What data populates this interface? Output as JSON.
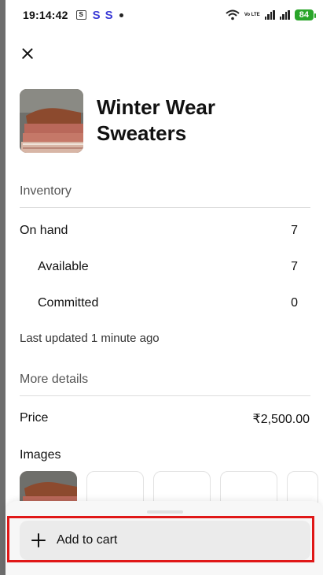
{
  "status_bar": {
    "time": "19:14:42",
    "sim_label": "S",
    "notif_1": "S",
    "notif_2": "S",
    "volte_text": "Vo LTE",
    "battery": "84"
  },
  "product": {
    "title": "Winter Wear Sweaters",
    "thumbnail_icon": "sweater-photo"
  },
  "inventory": {
    "heading": "Inventory",
    "on_hand_label": "On hand",
    "on_hand_value": "7",
    "available_label": "Available",
    "available_value": "7",
    "committed_label": "Committed",
    "committed_value": "0",
    "last_updated": "Last updated 1 minute ago"
  },
  "details": {
    "heading": "More details",
    "price_label": "Price",
    "price_value": "₹2,500.00",
    "images_label": "Images"
  },
  "actions": {
    "add_to_cart_label": "Add to cart"
  },
  "colors": {
    "accent_highlight": "#e01818",
    "battery": "#2aa52a"
  }
}
